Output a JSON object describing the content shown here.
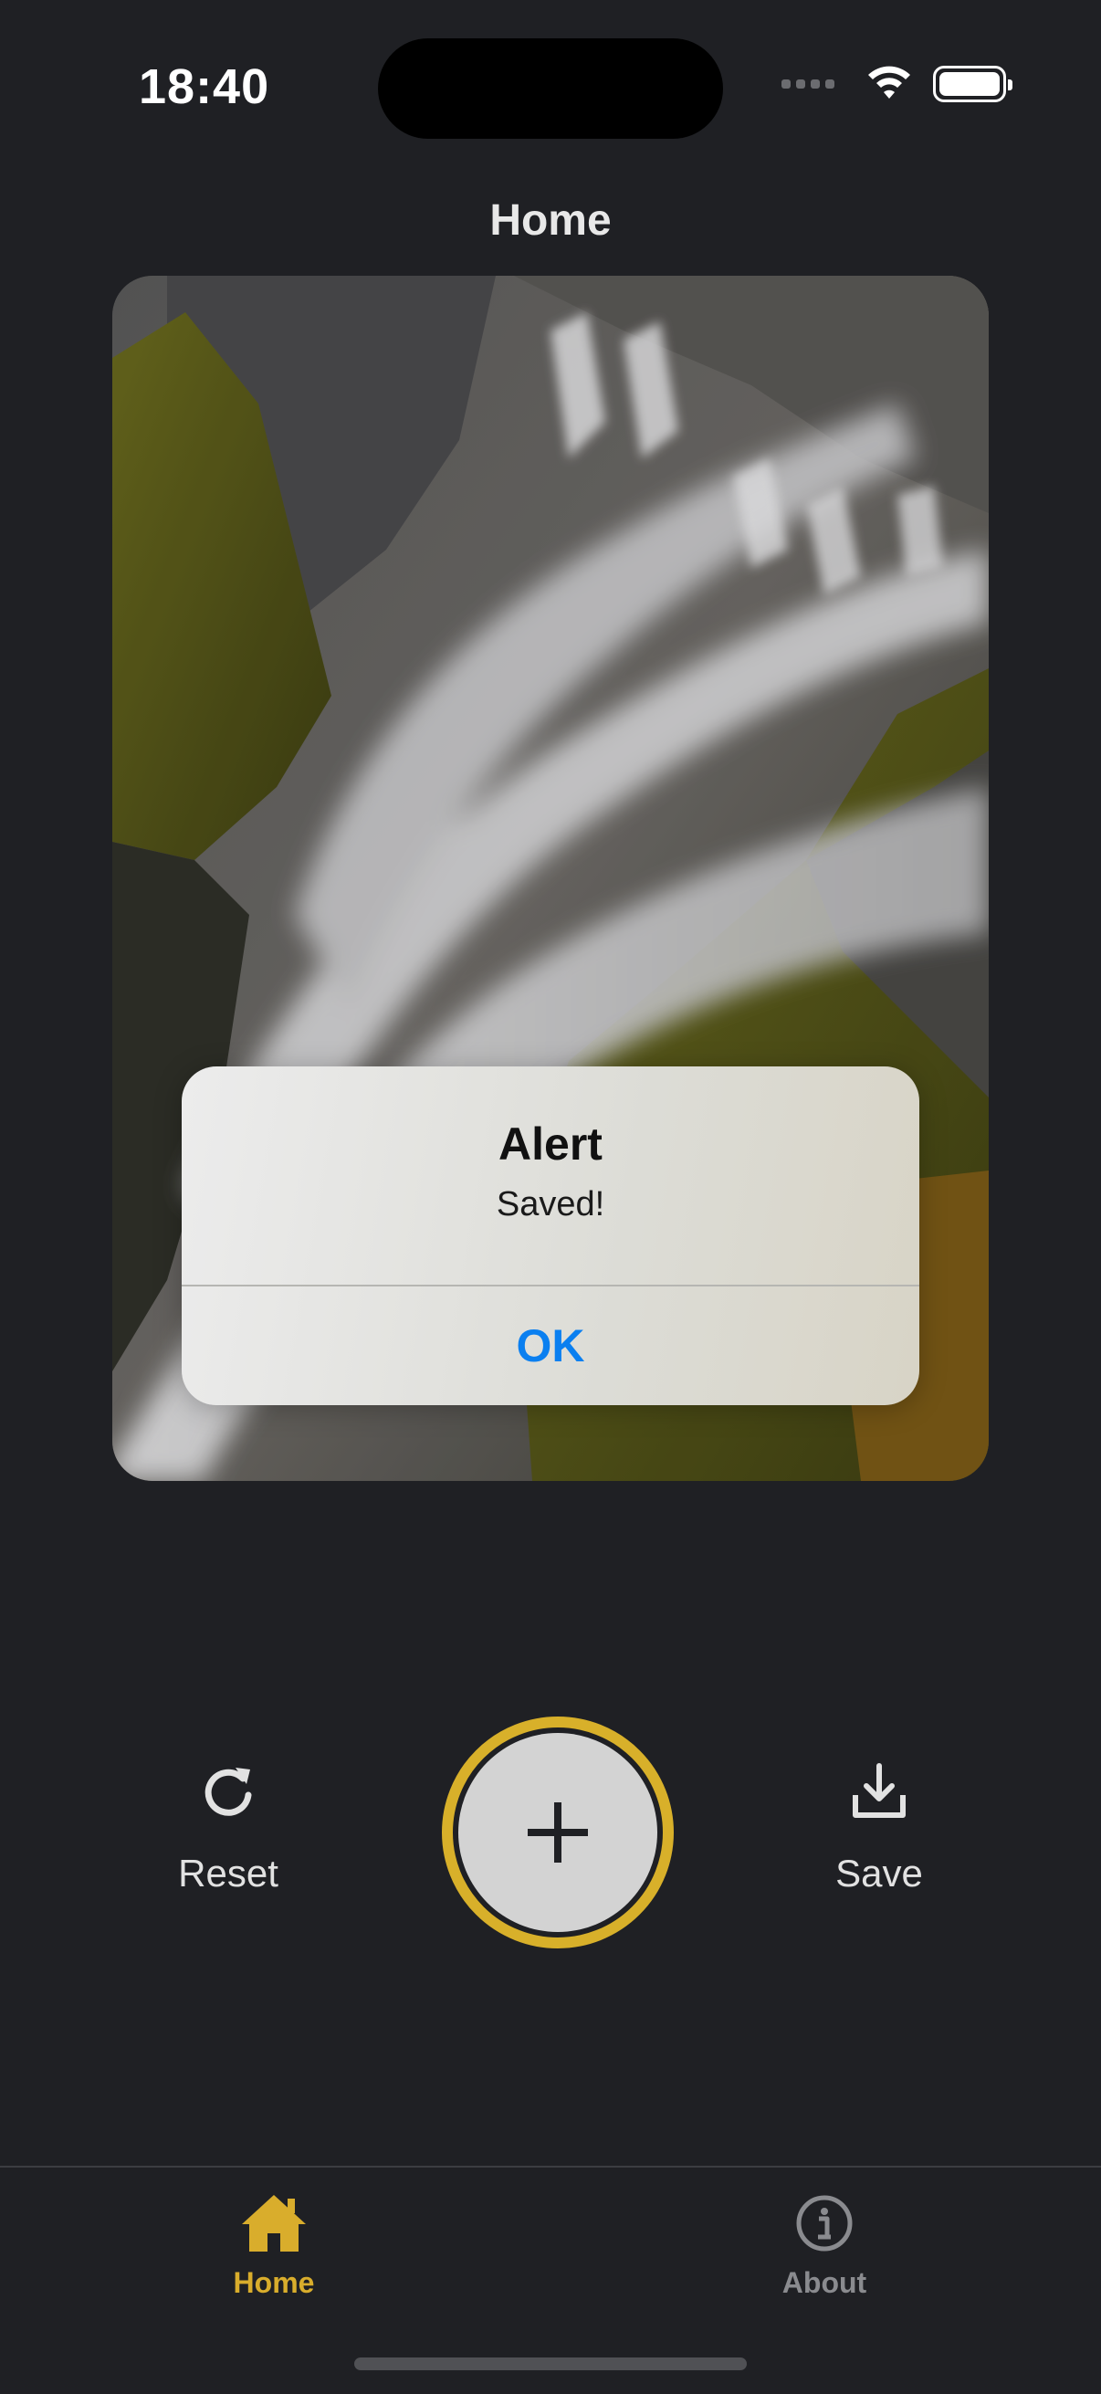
{
  "status_bar": {
    "time": "18:40"
  },
  "header": {
    "title": "Home"
  },
  "photo": {
    "description_icon": "waterfall-photo"
  },
  "alert": {
    "title": "Alert",
    "message": "Saved!",
    "ok_label": "OK",
    "ok_color": "#0a7ff0"
  },
  "actions": {
    "reset_label": "Reset",
    "reset_icon": "refresh-icon",
    "save_label": "Save",
    "save_icon": "download-icon",
    "add_icon": "plus-icon",
    "accent_color": "#d8b02a"
  },
  "tab_bar": {
    "tabs": [
      {
        "label": "Home",
        "icon": "house-icon",
        "active": true
      },
      {
        "label": "About",
        "icon": "info-icon",
        "active": false
      }
    ]
  }
}
